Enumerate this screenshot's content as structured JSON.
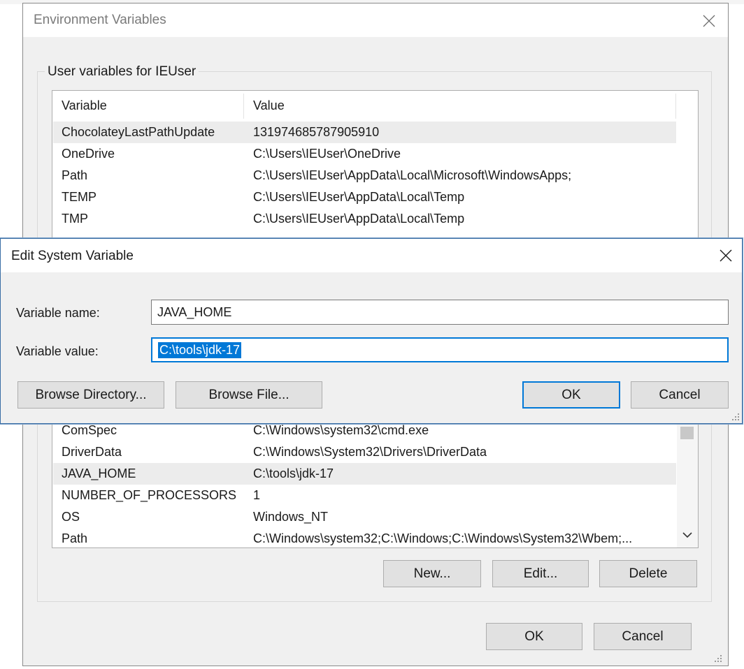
{
  "env_window": {
    "title": "Environment Variables",
    "user_group_label": "User variables for IEUser",
    "columns": {
      "variable": "Variable",
      "value": "Value"
    },
    "user_variables": [
      {
        "variable": "ChocolateyLastPathUpdate",
        "value": "131974685787905910",
        "selected": true
      },
      {
        "variable": "OneDrive",
        "value": "C:\\Users\\IEUser\\OneDrive",
        "selected": false
      },
      {
        "variable": "Path",
        "value": "C:\\Users\\IEUser\\AppData\\Local\\Microsoft\\WindowsApps;",
        "selected": false
      },
      {
        "variable": "TEMP",
        "value": "C:\\Users\\IEUser\\AppData\\Local\\Temp",
        "selected": false
      },
      {
        "variable": "TMP",
        "value": "C:\\Users\\IEUser\\AppData\\Local\\Temp",
        "selected": false
      }
    ],
    "system_variables": [
      {
        "variable": "ComSpec",
        "value": "C:\\Windows\\system32\\cmd.exe",
        "selected": false
      },
      {
        "variable": "DriverData",
        "value": "C:\\Windows\\System32\\Drivers\\DriverData",
        "selected": false
      },
      {
        "variable": "JAVA_HOME",
        "value": "C:\\tools\\jdk-17",
        "selected": true
      },
      {
        "variable": "NUMBER_OF_PROCESSORS",
        "value": "1",
        "selected": false
      },
      {
        "variable": "OS",
        "value": "Windows_NT",
        "selected": false
      },
      {
        "variable": "Path",
        "value": "C:\\Windows\\system32;C:\\Windows;C:\\Windows\\System32\\Wbem;...",
        "selected": false
      }
    ],
    "buttons": {
      "new": "New...",
      "edit": "Edit...",
      "delete": "Delete",
      "ok": "OK",
      "cancel": "Cancel"
    },
    "icons": {
      "close": "close-icon",
      "scroll_down": "chevron-down-icon"
    }
  },
  "edit_dialog": {
    "title": "Edit System Variable",
    "name_label": "Variable name:",
    "name_value": "JAVA_HOME",
    "value_label": "Variable value:",
    "value_value": "C:\\tools\\jdk-17",
    "buttons": {
      "browse_directory": "Browse Directory...",
      "browse_file": "Browse File...",
      "ok": "OK",
      "cancel": "Cancel"
    }
  },
  "colors": {
    "accent": "#0078d7",
    "selection": "#ececec",
    "window_bg": "#f0f0f0"
  }
}
